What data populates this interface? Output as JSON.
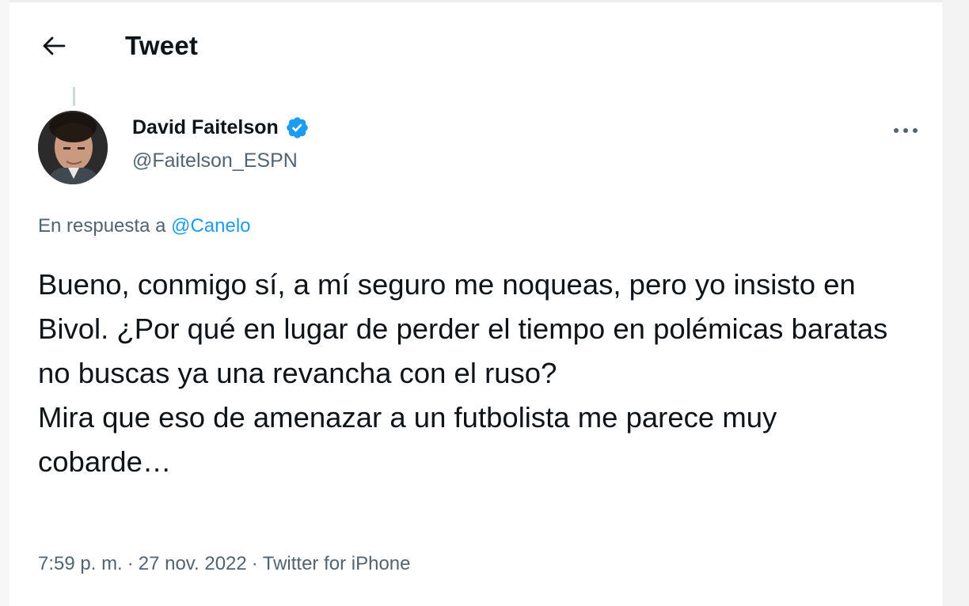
{
  "header": {
    "back_icon": "arrow-left-icon",
    "title": "Tweet"
  },
  "author": {
    "display_name": "David Faitelson",
    "verified": true,
    "verified_color": "#1d9bf0",
    "handle": "@Faitelson_ESPN",
    "avatar_icon": "user-avatar"
  },
  "more_icon": "more-horizontal-icon",
  "reply": {
    "prefix": "En respuesta a",
    "mention": "@Canelo"
  },
  "tweet": {
    "paragraph_1": "Bueno, conmigo sí, a mí seguro me noqueas, pero yo insisto en Bivol. ¿Por qué en lugar de perder el tiempo en polémicas baratas no buscas ya una revancha con el ruso?",
    "paragraph_2": "Mira que eso de amenazar a un futbolista me parece muy cobarde…"
  },
  "meta": {
    "time": "7:59 p. m.",
    "separator": "·",
    "date": "27 nov. 2022",
    "source": "Twitter for iPhone"
  },
  "colors": {
    "text": "#0f1419",
    "secondary": "#536471",
    "link": "#1d9bf0"
  }
}
